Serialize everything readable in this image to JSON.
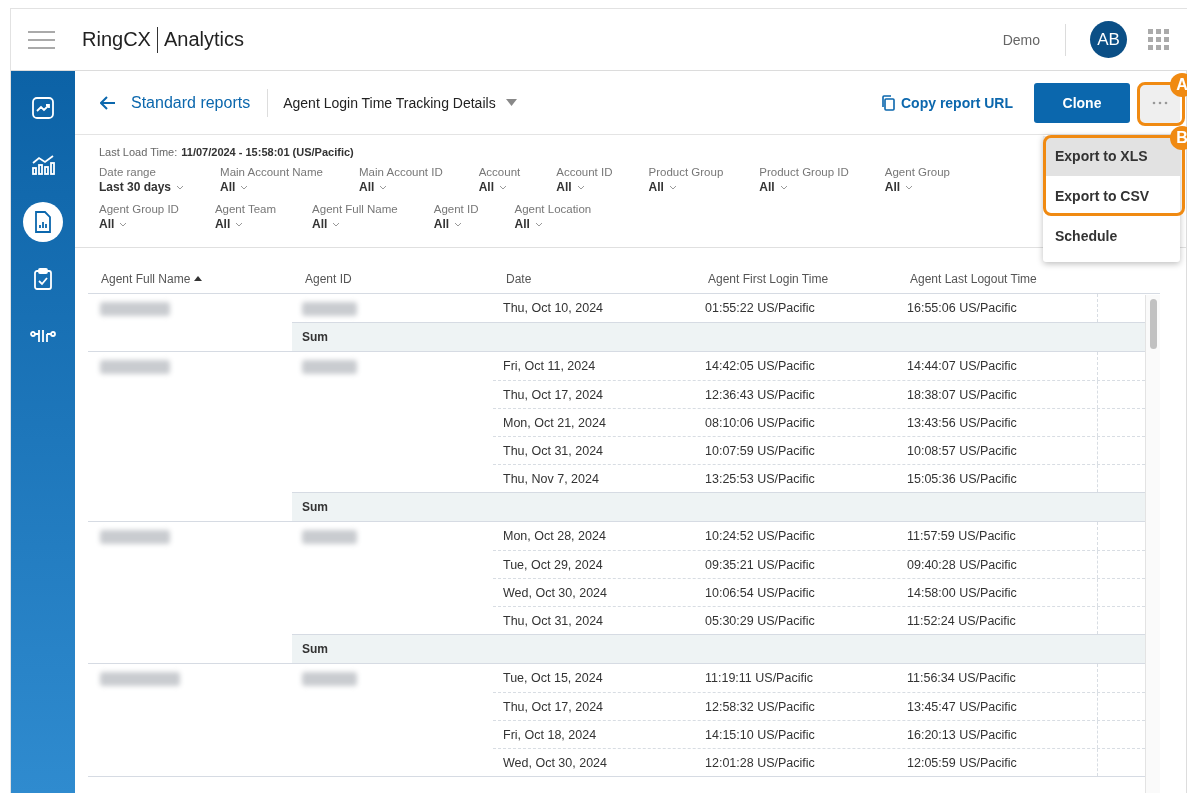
{
  "header": {
    "brand": {
      "product": "RingCX",
      "module": "Analytics"
    },
    "account": "Demo",
    "avatar": "AB"
  },
  "sidebar": {
    "items": [
      {
        "selected": false
      },
      {
        "selected": false
      },
      {
        "selected": true
      },
      {
        "selected": false
      },
      {
        "selected": false
      }
    ]
  },
  "toolbar": {
    "back_link": "Standard reports",
    "report_title": "Agent Login Time Tracking Details",
    "copy_link": "Copy report URL",
    "clone_button": "Clone"
  },
  "more_menu": {
    "items": [
      {
        "label": "Export to XLS",
        "highlighted": true
      },
      {
        "label": "Export to CSV",
        "highlighted": false
      },
      {
        "label": "Schedule",
        "highlighted": false
      }
    ]
  },
  "callouts": [
    {
      "label": "A"
    },
    {
      "label": "B"
    }
  ],
  "last_load": {
    "label": "Last Load Time:",
    "value": "11/07/2024 - 15:58:01 (US/Pacific)"
  },
  "filter_rows": [
    [
      {
        "label": "Date range",
        "value": "Last 30 days"
      },
      {
        "label": "Main Account Name",
        "value": "All"
      },
      {
        "label": "Main Account ID",
        "value": "All"
      },
      {
        "label": "Account",
        "value": "All"
      },
      {
        "label": "Account ID",
        "value": "All"
      },
      {
        "label": "Product Group",
        "value": "All"
      },
      {
        "label": "Product Group ID",
        "value": "All"
      },
      {
        "label": "Agent Group",
        "value": "All"
      }
    ],
    [
      {
        "label": "Agent Group ID",
        "value": "All"
      },
      {
        "label": "Agent Team",
        "value": "All"
      },
      {
        "label": "Agent Full Name",
        "value": "All"
      },
      {
        "label": "Agent ID",
        "value": "All"
      },
      {
        "label": "Agent Location",
        "value": "All"
      }
    ]
  ],
  "table": {
    "columns": [
      {
        "label": "Agent Full Name",
        "sorted": true
      },
      {
        "label": "Agent ID",
        "sorted": false
      },
      {
        "label": "Date",
        "sorted": false
      },
      {
        "label": "Agent First Login Time",
        "sorted": false
      },
      {
        "label": "Agent Last Logout Time",
        "sorted": false
      }
    ],
    "groups": [
      {
        "sum_label": "Sum",
        "rows": [
          {
            "date": "Thu, Oct 10, 2024",
            "first_login": "01:55:22 US/Pacific",
            "last_logout": "16:55:06 US/Pacific"
          }
        ]
      },
      {
        "sum_label": "Sum",
        "rows": [
          {
            "date": "Fri, Oct 11, 2024",
            "first_login": "14:42:05 US/Pacific",
            "last_logout": "14:44:07 US/Pacific"
          },
          {
            "date": "Thu, Oct 17, 2024",
            "first_login": "12:36:43 US/Pacific",
            "last_logout": "18:38:07 US/Pacific"
          },
          {
            "date": "Mon, Oct 21, 2024",
            "first_login": "08:10:06 US/Pacific",
            "last_logout": "13:43:56 US/Pacific"
          },
          {
            "date": "Thu, Oct 31, 2024",
            "first_login": "10:07:59 US/Pacific",
            "last_logout": "10:08:57 US/Pacific"
          },
          {
            "date": "Thu, Nov 7, 2024",
            "first_login": "13:25:53 US/Pacific",
            "last_logout": "15:05:36 US/Pacific"
          }
        ]
      },
      {
        "sum_label": "Sum",
        "rows": [
          {
            "date": "Mon, Oct 28, 2024",
            "first_login": "10:24:52 US/Pacific",
            "last_logout": "11:57:59 US/Pacific"
          },
          {
            "date": "Tue, Oct 29, 2024",
            "first_login": "09:35:21 US/Pacific",
            "last_logout": "09:40:28 US/Pacific"
          },
          {
            "date": "Wed, Oct 30, 2024",
            "first_login": "10:06:54 US/Pacific",
            "last_logout": "14:58:00 US/Pacific"
          },
          {
            "date": "Thu, Oct 31, 2024",
            "first_login": "05:30:29 US/Pacific",
            "last_logout": "11:52:24 US/Pacific"
          }
        ]
      },
      {
        "rows": [
          {
            "date": "Tue, Oct 15, 2024",
            "first_login": "11:19:11 US/Pacific",
            "last_logout": "11:56:34 US/Pacific"
          },
          {
            "date": "Thu, Oct 17, 2024",
            "first_login": "12:58:32 US/Pacific",
            "last_logout": "13:45:47 US/Pacific"
          },
          {
            "date": "Fri, Oct 18, 2024",
            "first_login": "14:15:10 US/Pacific",
            "last_logout": "16:20:13 US/Pacific"
          },
          {
            "date": "Wed, Oct 30, 2024",
            "first_login": "12:01:28 US/Pacific",
            "last_logout": "12:05:59 US/Pacific"
          }
        ]
      }
    ]
  }
}
